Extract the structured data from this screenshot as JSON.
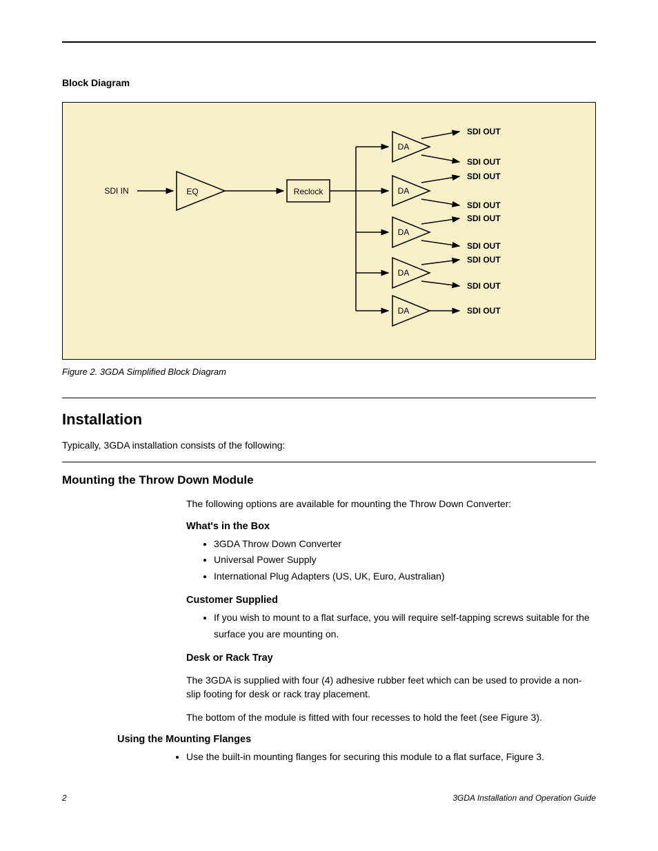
{
  "section_title": "Block Diagram",
  "diagram": {
    "input_label": "SDI IN",
    "eq_label": "EQ",
    "reclock_label": "Reclock",
    "da_label": "DA",
    "output_label": "SDI OUT"
  },
  "figure_caption": "Figure 2.  3GDA Simplified Block Diagram",
  "h1": "Installation",
  "h1_para": "Typically, 3GDA installation consists of the following:",
  "h2": "Mounting the Throw Down Module",
  "content": {
    "mount_para": "The following options are available for mounting the Throw Down Converter:",
    "h3a": "What's in the Box",
    "box_items": [
      "3GDA Throw Down Converter",
      "Universal Power Supply",
      "International Plug Adapters (US, UK, Euro, Australian)"
    ],
    "h3b": "Customer Supplied",
    "customer_items": [
      "If you wish to mount to a flat surface, you will require self-tapping screws suitable for the surface you are mounting on."
    ],
    "h3c": "Desk or Rack Tray",
    "desk_para1": "The 3GDA is supplied with four (4) adhesive rubber feet which can be used to provide a non-slip footing for desk or rack tray placement.",
    "desk_para2": "The bottom of the module is fitted with four recesses to hold the feet (see Figure 3).",
    "h3d": "Using the Mounting Flanges",
    "flange_items": [
      "Use the built-in mounting flanges for securing this module to a flat surface, Figure 3."
    ]
  },
  "footer": {
    "left": "2",
    "right": "3GDA Installation and Operation Guide"
  }
}
